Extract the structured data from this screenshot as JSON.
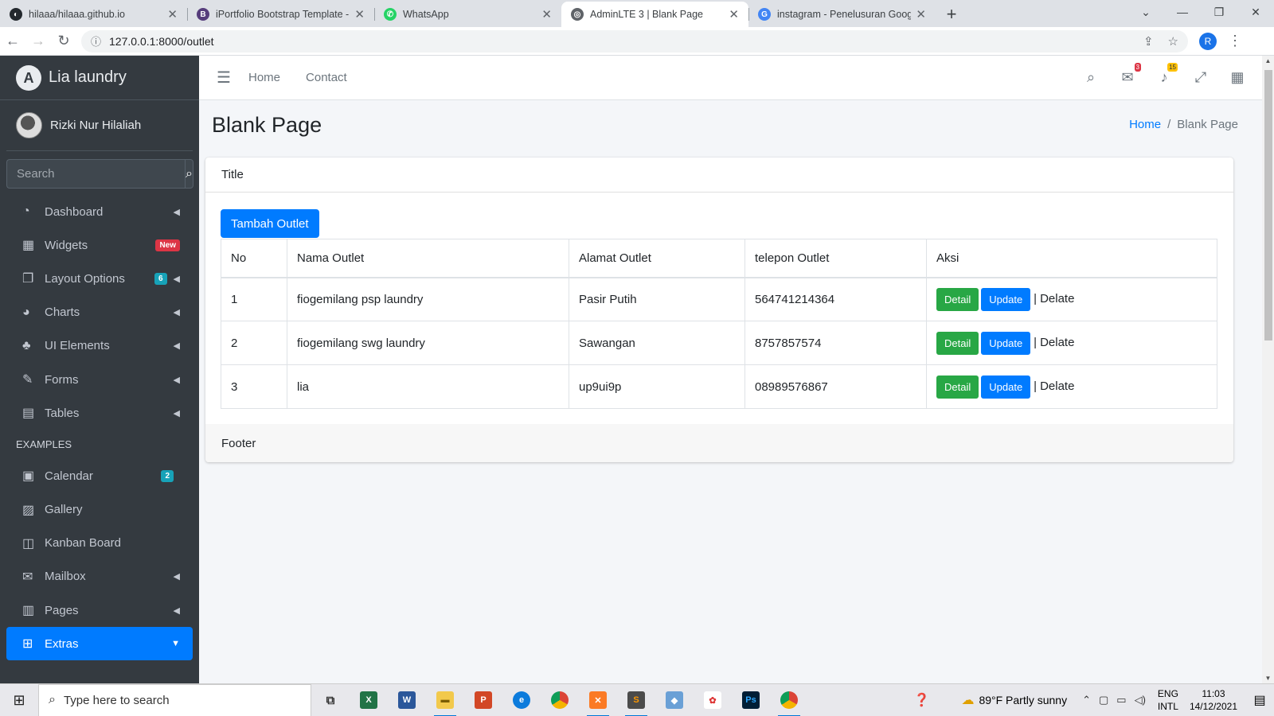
{
  "browser": {
    "tabs": [
      {
        "title": "hilaaa/hilaaa.github.io",
        "icon": "github-icon",
        "color": "#24292e",
        "glyph": "◐"
      },
      {
        "title": "iPortfolio Bootstrap Template - In",
        "icon": "bootstrap-icon",
        "color": "#563d7c",
        "glyph": "B"
      },
      {
        "title": "WhatsApp",
        "icon": "whatsapp-icon",
        "color": "#25d366",
        "glyph": "✆"
      },
      {
        "title": "AdminLTE 3 | Blank Page",
        "icon": "globe-icon",
        "color": "#5f6368",
        "glyph": "◎",
        "active": true
      },
      {
        "title": "instagram - Penelusuran Google",
        "icon": "google-icon",
        "color": "#4285f4",
        "glyph": "G"
      }
    ],
    "url": "127.0.0.1:8000/outlet",
    "profile_initial": "R"
  },
  "sidebar": {
    "brand": "Lia laundry",
    "brand_logo": "A",
    "user": "Rizki Nur Hilaliah",
    "search_placeholder": "Search",
    "items": [
      {
        "label": "Dashboard",
        "icon": "tachometer-icon",
        "glyph": "◔",
        "arrow": true
      },
      {
        "label": "Widgets",
        "icon": "th-icon",
        "glyph": "▦",
        "badge": "New",
        "badge_color": "red"
      },
      {
        "label": "Layout Options",
        "icon": "copy-icon",
        "glyph": "❐",
        "badge": "6",
        "badge_color": "teal",
        "arrow": true
      },
      {
        "label": "Charts",
        "icon": "pie-chart-icon",
        "glyph": "◕",
        "arrow": true
      },
      {
        "label": "UI Elements",
        "icon": "tree-icon",
        "glyph": "♣",
        "arrow": true
      },
      {
        "label": "Forms",
        "icon": "edit-icon",
        "glyph": "✎",
        "arrow": true
      },
      {
        "label": "Tables",
        "icon": "table-icon",
        "glyph": "▤",
        "arrow": true
      }
    ],
    "header": "EXAMPLES",
    "items2": [
      {
        "label": "Calendar",
        "icon": "calendar-icon",
        "glyph": "▣",
        "badge": "2",
        "badge_color": "teal"
      },
      {
        "label": "Gallery",
        "icon": "image-icon",
        "glyph": "▨"
      },
      {
        "label": "Kanban Board",
        "icon": "columns-icon",
        "glyph": "◫"
      },
      {
        "label": "Mailbox",
        "icon": "envelope-icon",
        "glyph": "✉",
        "arrow": true
      },
      {
        "label": "Pages",
        "icon": "book-icon",
        "glyph": "▥",
        "arrow": true
      },
      {
        "label": "Extras",
        "icon": "plus-square-icon",
        "glyph": "⊞",
        "arrow_down": true,
        "active": true
      }
    ]
  },
  "topnav": {
    "links": [
      "Home",
      "Contact"
    ],
    "messages_count": "3",
    "notifications_count": "15"
  },
  "page": {
    "title": "Blank Page",
    "breadcrumb": [
      "Home",
      "Blank Page"
    ]
  },
  "card": {
    "title": "Title",
    "add_button": "Tambah Outlet",
    "columns": [
      "No",
      "Nama Outlet",
      "Alamat Outlet",
      "telepon Outlet",
      "Aksi"
    ],
    "rows": [
      {
        "no": "1",
        "nama": "fiogemilang psp laundry",
        "alamat": "Pasir Putih",
        "telepon": "564741214364"
      },
      {
        "no": "2",
        "nama": "fiogemilang swg laundry",
        "alamat": "Sawangan",
        "telepon": "8757857574"
      },
      {
        "no": "3",
        "nama": "lia",
        "alamat": "up9ui9p",
        "telepon": "08989576867"
      }
    ],
    "actions": {
      "detail": "Detail",
      "update": "Update",
      "separator": "|",
      "delete": "Delate"
    },
    "footer": "Footer"
  },
  "taskbar": {
    "search_placeholder": "Type here to search",
    "weather": "89°F  Partly sunny",
    "lang_line1": "ENG",
    "lang_line2": "INTL",
    "time": "11:03",
    "date": "14/12/2021"
  },
  "colors": {
    "primary": "#007bff",
    "success": "#28a745",
    "sidebar": "#343a40",
    "danger": "#dc3545",
    "info": "#17a2b8",
    "warning": "#ffc107"
  }
}
